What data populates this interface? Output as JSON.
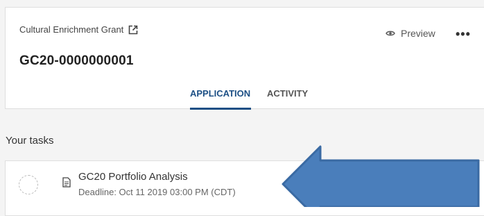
{
  "header": {
    "grant_title": "Cultural Enrichment Grant",
    "application_id": "GC20-0000000001",
    "preview_label": "Preview",
    "more_label": "•••"
  },
  "tabs": [
    {
      "label": "APPLICATION",
      "active": true
    },
    {
      "label": "ACTIVITY",
      "active": false
    }
  ],
  "tasks_section": {
    "title": "Your tasks",
    "items": [
      {
        "name": "GC20 Portfolio Analysis",
        "deadline": "Deadline: Oct 11 2019 03:00 PM (CDT)",
        "status": "not-started"
      }
    ]
  },
  "colors": {
    "accent": "#1c4f85",
    "arrow_fill": "#4a7ebb",
    "arrow_stroke": "#3a6aa3",
    "background": "#f4f4f4"
  },
  "icons": [
    "external-link-icon",
    "eye-icon",
    "more-icon",
    "document-icon",
    "chevron-right-icon",
    "arrow-annotation"
  ]
}
